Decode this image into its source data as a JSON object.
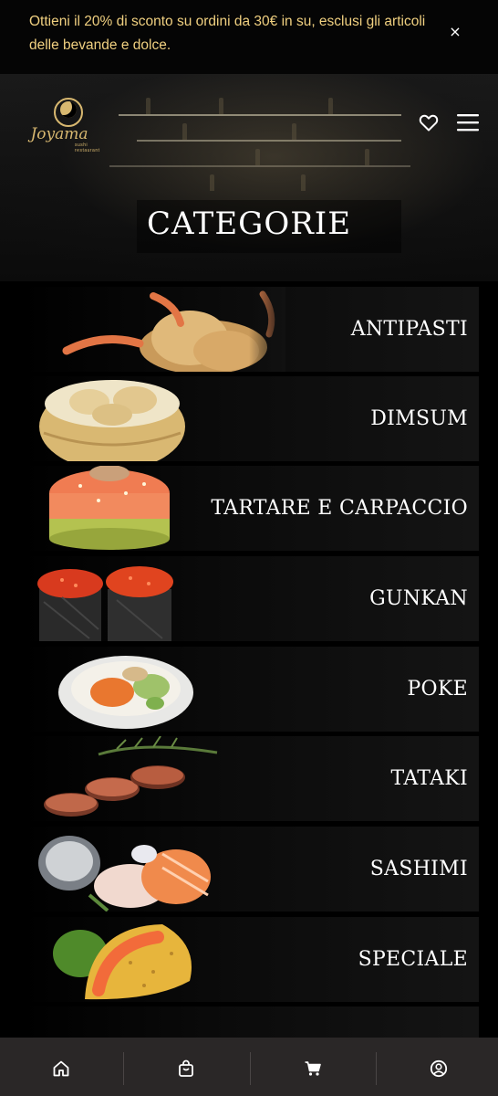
{
  "promo": {
    "text": "Ottieni il 20% di sconto su ordini da 30€ in su, esclusi gli articoli delle bevande e dolce.",
    "close_label": "×"
  },
  "header": {
    "logo_name": "Joyama",
    "logo_sub": "sushi restaurant",
    "title": "CATEGORIE",
    "icons": [
      "heart-icon",
      "menu-icon"
    ]
  },
  "categories": [
    {
      "label": "ANTIPASTI"
    },
    {
      "label": "DIMSUM"
    },
    {
      "label": "TARTARE E CARPACCIO"
    },
    {
      "label": "GUNKAN"
    },
    {
      "label": "POKE"
    },
    {
      "label": "TATAKI"
    },
    {
      "label": "SASHIMI"
    },
    {
      "label": "SPECIALE"
    }
  ],
  "bottom_nav": {
    "items": [
      "home-icon",
      "shopping-bag-icon",
      "cart-icon",
      "user-account-icon"
    ]
  },
  "colors": {
    "accent_gold": "#f0d080",
    "logo_gold": "#d8b870",
    "nav_background": "#2a2727",
    "background": "#000000"
  }
}
